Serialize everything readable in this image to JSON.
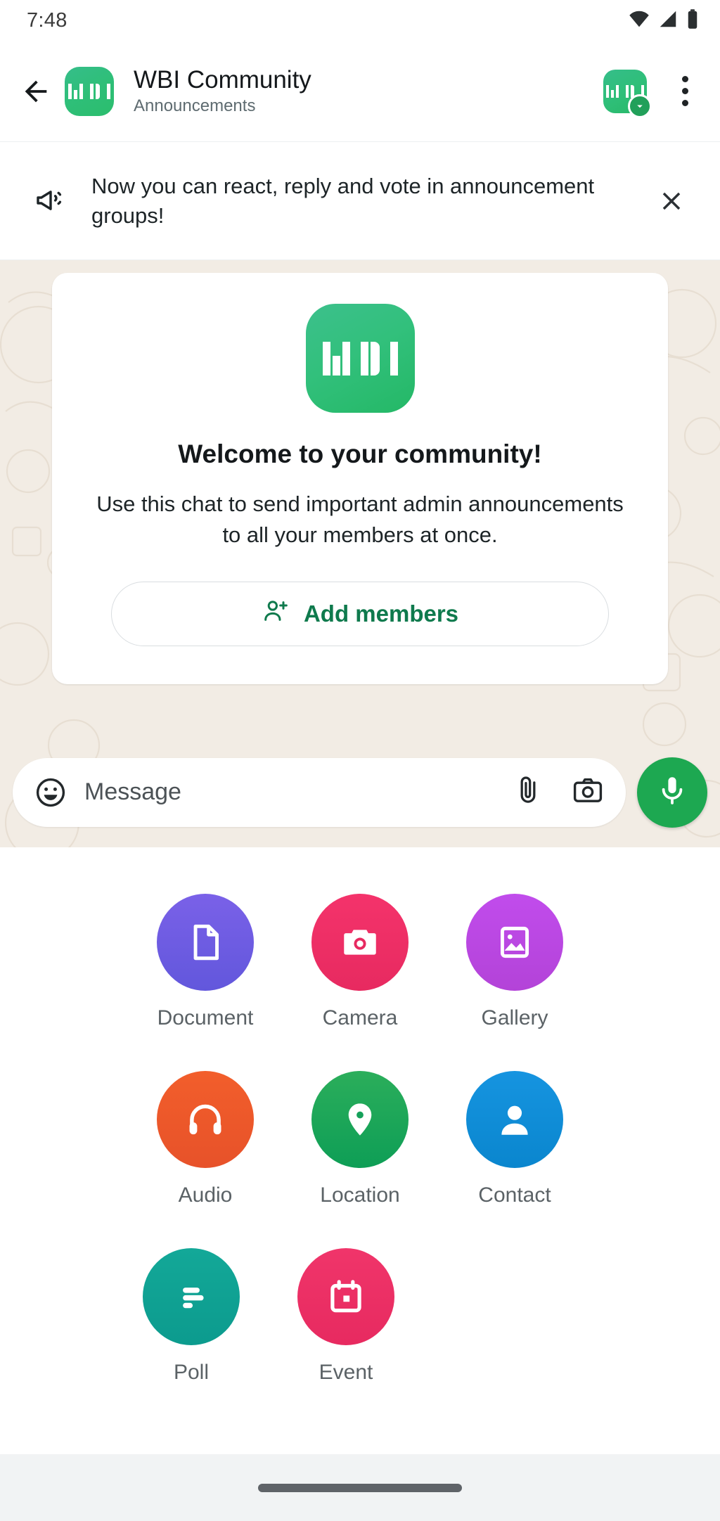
{
  "status_bar": {
    "time": "7:48",
    "icons": [
      "wifi-icon",
      "signal-icon",
      "battery-icon"
    ]
  },
  "app_bar": {
    "back_icon": "back-arrow-icon",
    "avatar_label": "WBI",
    "title": "WBI Community",
    "subtitle": "Announcements",
    "community_avatar_label": "WBI",
    "community_badge_icon": "chevron-down-icon",
    "overflow_icon": "more-vertical-icon"
  },
  "banner": {
    "icon": "megaphone-icon",
    "text": "Now you can react, reply and vote in announcement groups!",
    "close_icon": "close-icon"
  },
  "welcome_card": {
    "logo_label": "WBI",
    "title": "Welcome to your community!",
    "body": "Use this chat to send important admin announcements to all your members at once.",
    "add_members_icon": "person-add-icon",
    "add_members_label": "Add members"
  },
  "composer": {
    "emoji_icon": "emoji-smiley-icon",
    "placeholder": "Message",
    "attach_icon": "paperclip-icon",
    "camera_icon": "camera-icon",
    "mic_icon": "microphone-icon"
  },
  "attachment_panel": {
    "rows": [
      [
        {
          "label": "Document",
          "icon": "document-icon",
          "color": "#6257DC",
          "color2": "#7A61E8"
        },
        {
          "label": "Camera",
          "icon": "camera-icon",
          "color": "#E72A60",
          "color2": "#F4336B"
        },
        {
          "label": "Gallery",
          "icon": "gallery-icon",
          "color": "#BA4DE0",
          "color2": "#C14CEC"
        }
      ],
      [
        {
          "label": "Audio",
          "icon": "headphones-icon",
          "color": "#E7522A",
          "color2": "#F25E2B"
        },
        {
          "label": "Location",
          "icon": "location-pin-icon",
          "color": "#0E9E56",
          "color2": "#2BAE5B"
        },
        {
          "label": "Contact",
          "icon": "person-icon",
          "color": "#0A86CE",
          "color2": "#1694E0"
        }
      ],
      [
        {
          "label": "Poll",
          "icon": "poll-bars-icon",
          "color": "#0C9B8E",
          "color2": "#13A898"
        },
        {
          "label": "Event",
          "icon": "calendar-icon",
          "color": "#E72A60",
          "color2": "#F0356A"
        }
      ]
    ]
  },
  "nav_bar": {
    "pill": "home-gesture-pill"
  },
  "colors": {
    "brand_green": "#1da851",
    "accent_green": "#0f7a4d",
    "chat_wallpaper": "#f2ece4",
    "app_bar_bg": "#ffffff"
  }
}
